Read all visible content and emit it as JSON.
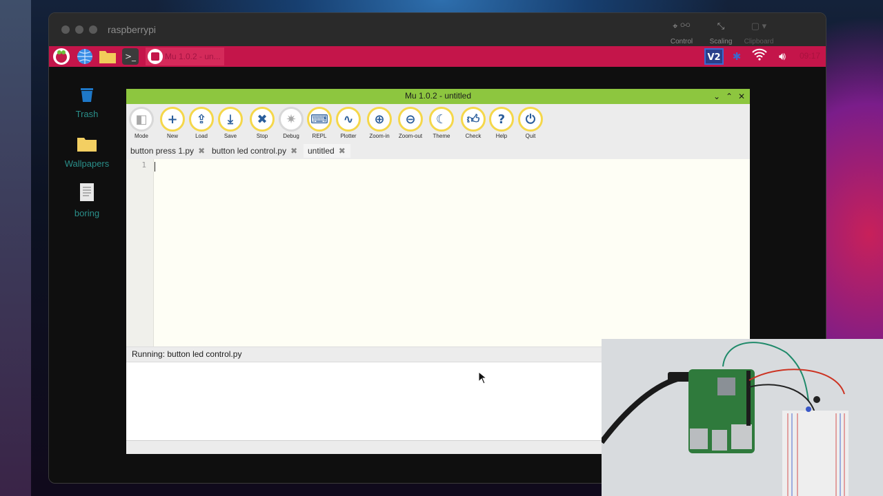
{
  "vnc": {
    "title": "raspberrypi",
    "toolbar": [
      {
        "label": "Control",
        "icon": "pointer-icon"
      },
      {
        "label": "Scaling",
        "icon": "scaling-icon"
      },
      {
        "label": "Clipboard",
        "icon": "clipboard-icon"
      }
    ]
  },
  "taskbar": {
    "app_label": "Mu 1.0.2 - un...",
    "clock": "09:17"
  },
  "desktop": {
    "items": [
      {
        "label": "Trash",
        "icon": "trash-icon"
      },
      {
        "label": "Wallpapers",
        "icon": "folder-icon"
      },
      {
        "label": "boring",
        "icon": "document-icon"
      }
    ]
  },
  "mu": {
    "title": "Mu 1.0.2 - untitled",
    "toolbar": [
      {
        "label": "Mode",
        "icon": "mode-icon",
        "enabled": false
      },
      {
        "label": "New",
        "icon": "plus-icon",
        "enabled": true
      },
      {
        "label": "Load",
        "icon": "upload-icon",
        "enabled": true
      },
      {
        "label": "Save",
        "icon": "download-icon",
        "enabled": true
      },
      {
        "label": "Stop",
        "icon": "stop-icon",
        "enabled": true
      },
      {
        "label": "Debug",
        "icon": "bug-icon",
        "enabled": false
      },
      {
        "label": "REPL",
        "icon": "keyboard-icon",
        "enabled": true
      },
      {
        "label": "Plotter",
        "icon": "waveform-icon",
        "enabled": true
      },
      {
        "label": "Zoom-in",
        "icon": "zoom-in-icon",
        "enabled": true
      },
      {
        "label": "Zoom-out",
        "icon": "zoom-out-icon",
        "enabled": true
      },
      {
        "label": "Theme",
        "icon": "moon-icon",
        "enabled": true
      },
      {
        "label": "Check",
        "icon": "thumbs-up-icon",
        "enabled": true
      },
      {
        "label": "Help",
        "icon": "question-icon",
        "enabled": true
      },
      {
        "label": "Quit",
        "icon": "power-icon",
        "enabled": true
      }
    ],
    "tabs": [
      {
        "label": "button press 1.py",
        "active": false
      },
      {
        "label": "button led control.py",
        "active": false
      },
      {
        "label": "untitled",
        "active": true
      }
    ],
    "line_number": "1",
    "run_status": "Running: button led control.py"
  },
  "colors": {
    "taskbar": "#c4154a",
    "mu_titlebar": "#8dc63f",
    "toolbar_ring": "#f5d74a",
    "toolbar_icon": "#2a5d9b"
  }
}
